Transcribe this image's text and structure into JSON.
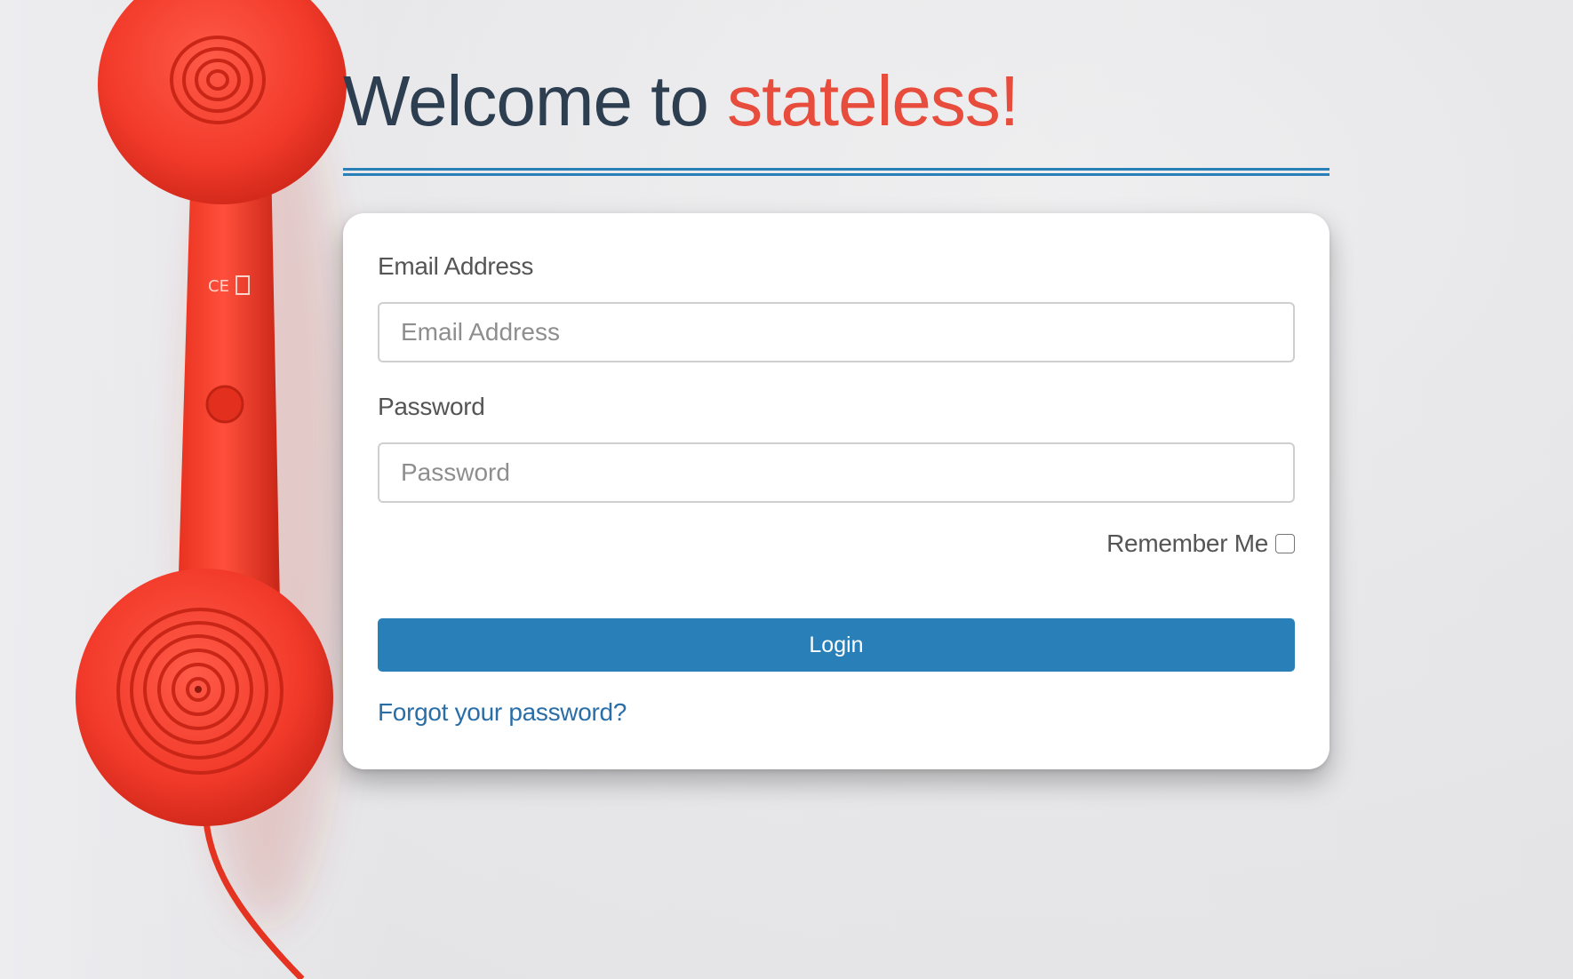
{
  "header": {
    "welcome_prefix": "Welcome to ",
    "brand_name": "stateless!"
  },
  "form": {
    "email_label": "Email Address",
    "email_placeholder": "Email Address",
    "email_value": "",
    "password_label": "Password",
    "password_placeholder": "Password",
    "password_value": "",
    "remember_label": "Remember Me",
    "remember_checked": false,
    "login_label": "Login",
    "forgot_label": "Forgot your password?"
  },
  "colors": {
    "heading": "#2c3e50",
    "brand": "#e74c3c",
    "accent": "#2980b9",
    "link": "#2a6ea8",
    "phone": "#f0402f"
  },
  "icons": {
    "background_image": "red-telephone-handset"
  }
}
